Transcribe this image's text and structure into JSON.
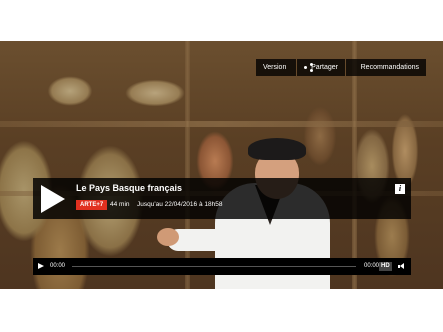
{
  "video": {
    "title": "Le Pays Basque français",
    "channel_badge": "ARTE+7",
    "duration": "44 min",
    "availability": "Jusqu'au 22/04/2016 à 18h58"
  },
  "top_buttons": {
    "version_label": "Version",
    "share_label": "Partager",
    "recommendations_label": "Recommandations"
  },
  "controls": {
    "current_time": "00:00",
    "total_time": "00:00",
    "quality_label": "HD",
    "progress": 0
  },
  "icons": {
    "play_big": "play-icon",
    "share": "share-icon",
    "recommendations": "grid-icon",
    "info": "info-icon",
    "play_small": "play-icon",
    "volume": "volume-icon"
  },
  "colors": {
    "badge": "#e1301f",
    "bar_background": "#000000"
  }
}
